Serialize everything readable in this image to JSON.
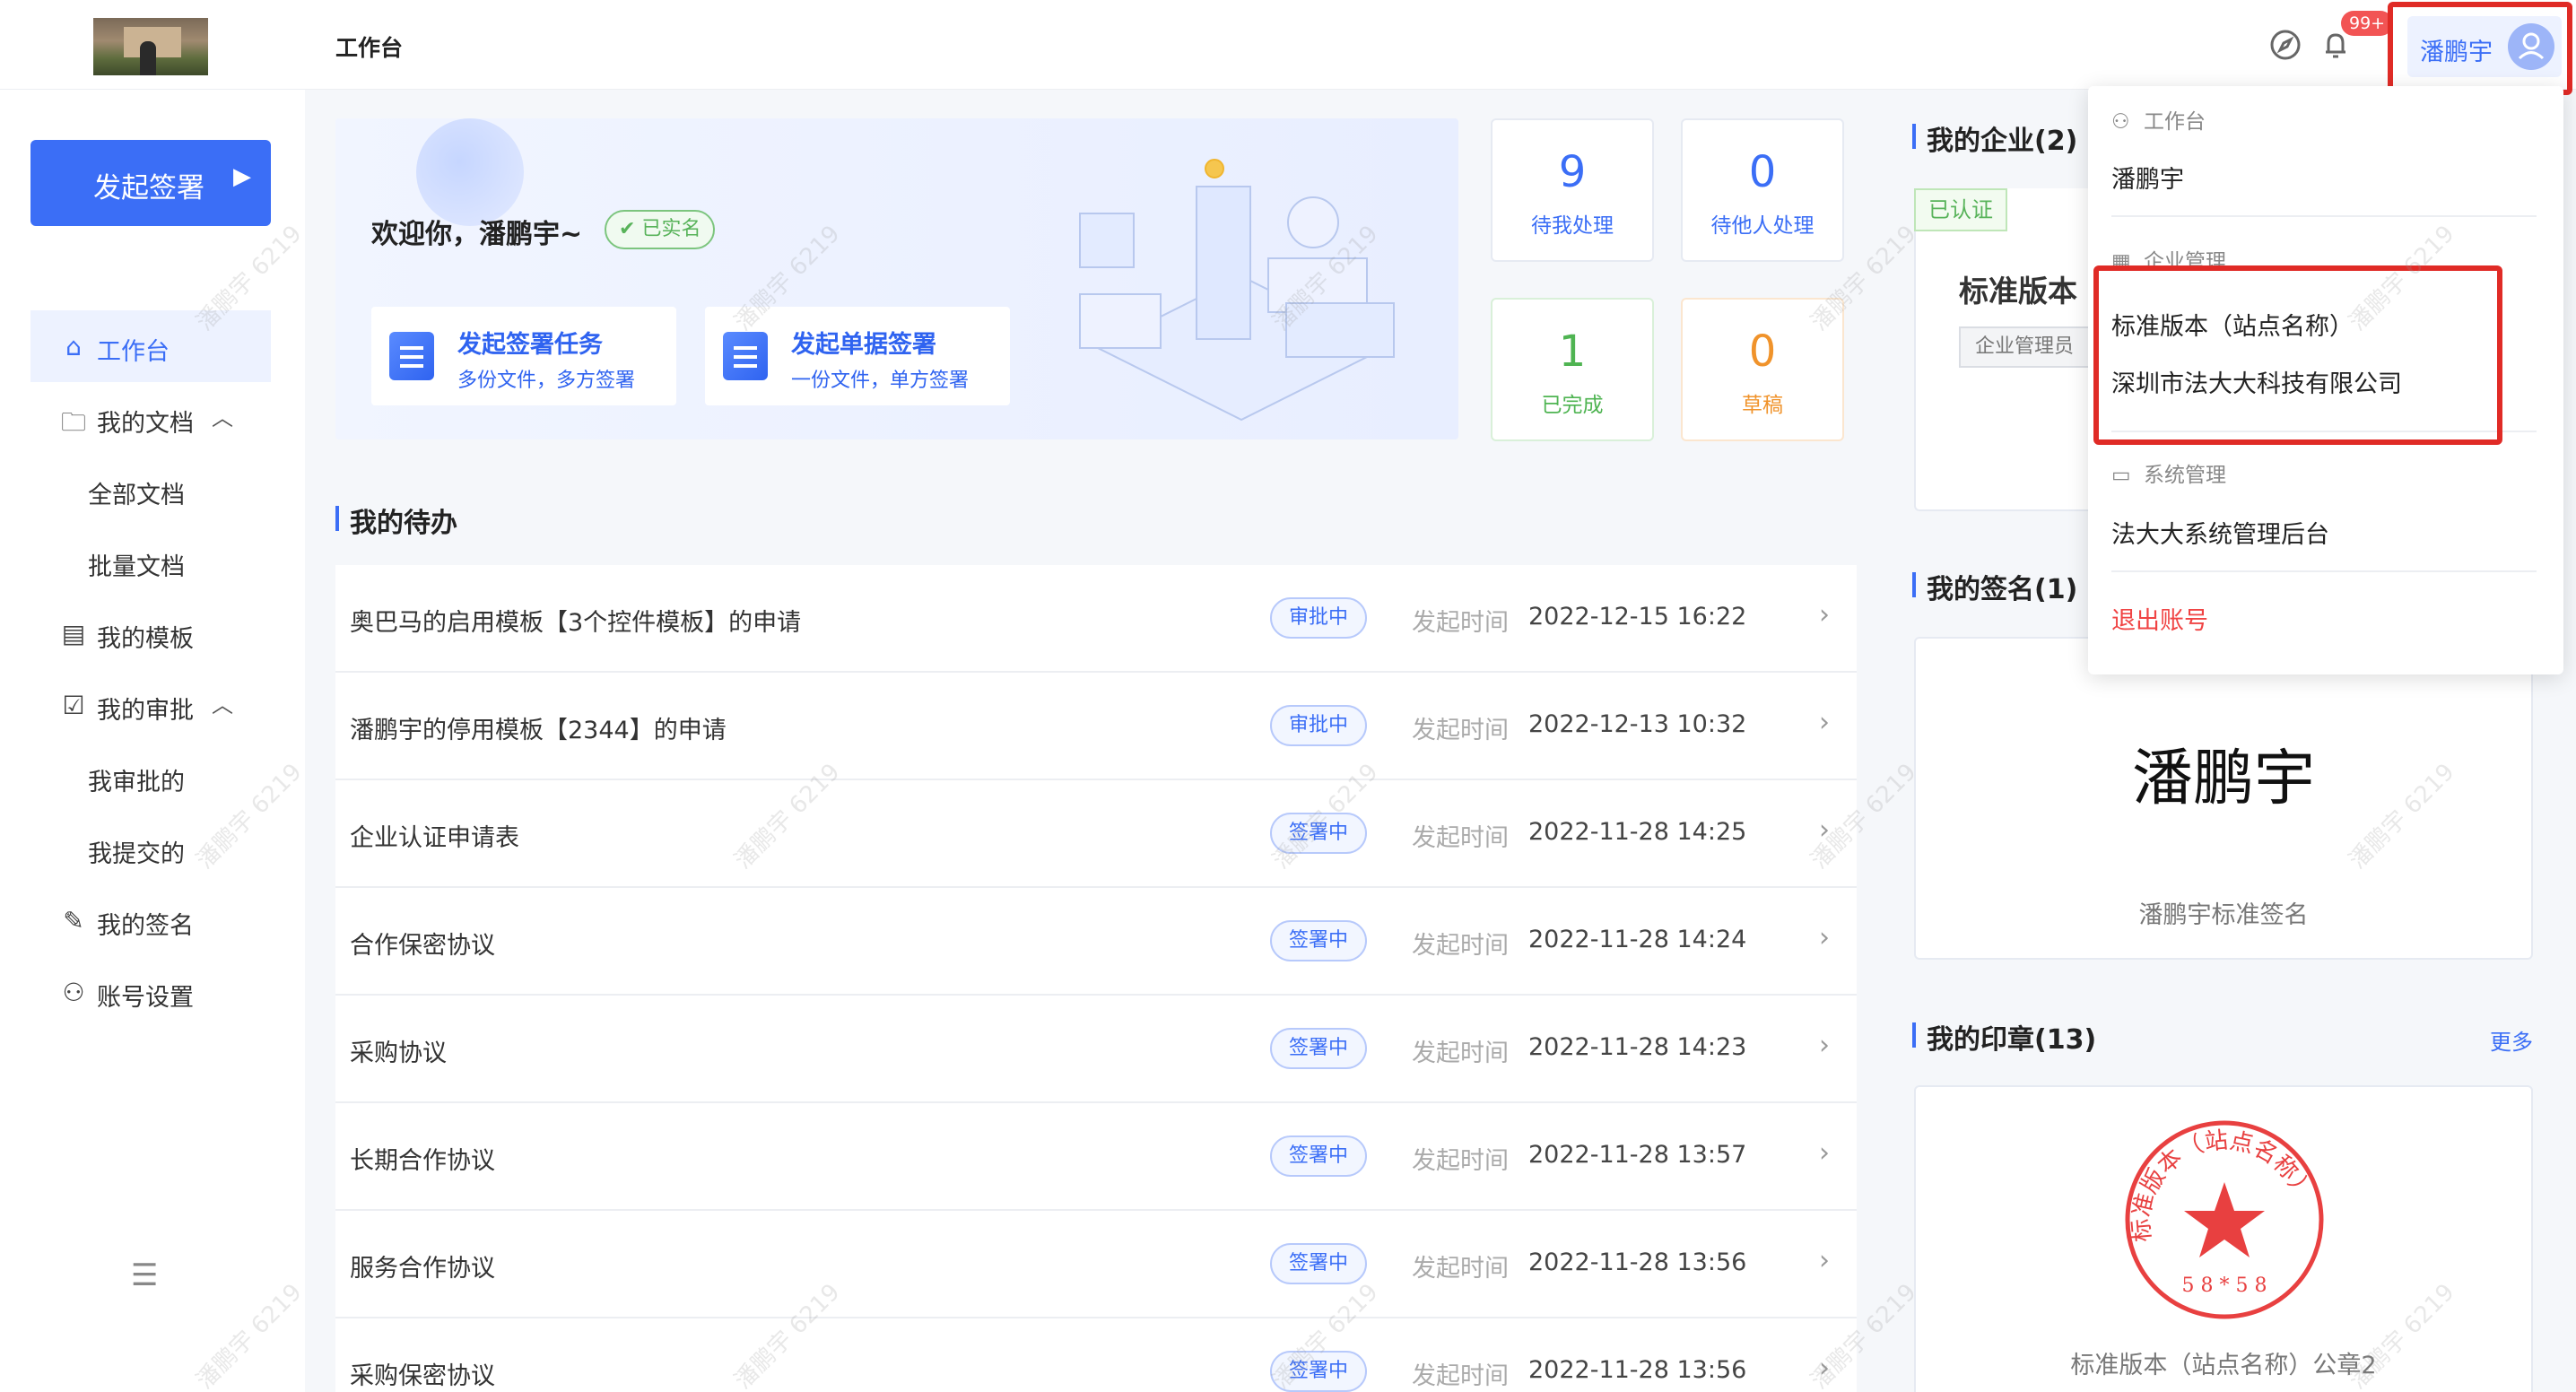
{
  "header": {
    "title": "工作台",
    "notification_badge": "99+",
    "user_name": "潘鹏宇"
  },
  "sidebar": {
    "start_button": "发起签署",
    "items": [
      {
        "label": "工作台",
        "icon": "home-icon"
      },
      {
        "label": "我的文档",
        "icon": "folder-icon"
      },
      {
        "label": "全部文档"
      },
      {
        "label": "批量文档"
      },
      {
        "label": "我的模板",
        "icon": "template-icon"
      },
      {
        "label": "我的审批",
        "icon": "approval-icon"
      },
      {
        "label": "我审批的"
      },
      {
        "label": "我提交的"
      },
      {
        "label": "我的签名",
        "icon": "pen-icon"
      },
      {
        "label": "账号设置",
        "icon": "user-icon"
      }
    ]
  },
  "banner": {
    "welcome": "欢迎你，潘鹏宇~",
    "verified": "已实名",
    "actions": [
      {
        "title": "发起签署任务",
        "subtitle": "多份文件，多方签署"
      },
      {
        "title": "发起单据签署",
        "subtitle": "一份文件，单方签署"
      }
    ]
  },
  "stats": [
    {
      "value": "9",
      "label": "待我处理"
    },
    {
      "value": "0",
      "label": "待他人处理"
    },
    {
      "value": "1",
      "label": "已完成"
    },
    {
      "value": "0",
      "label": "草稿"
    }
  ],
  "todo": {
    "title": "我的待办",
    "time_label": "发起时间",
    "rows": [
      {
        "name": "奥巴马的启用模板【3个控件模板】的申请",
        "status": "审批中",
        "time": "2022-12-15 16:22"
      },
      {
        "name": "潘鹏宇的停用模板【2344】的申请",
        "status": "审批中",
        "time": "2022-12-13 10:32"
      },
      {
        "name": "企业认证申请表",
        "status": "签署中",
        "time": "2022-11-28 14:25"
      },
      {
        "name": "合作保密协议",
        "status": "签署中",
        "time": "2022-11-28 14:24"
      },
      {
        "name": "采购协议",
        "status": "签署中",
        "time": "2022-11-28 14:23"
      },
      {
        "name": "长期合作协议",
        "status": "签署中",
        "time": "2022-11-28 13:57"
      },
      {
        "name": "服务合作协议",
        "status": "签署中",
        "time": "2022-11-28 13:56"
      },
      {
        "name": "采购保密协议",
        "status": "签署中",
        "time": "2022-11-28 13:56"
      }
    ]
  },
  "right": {
    "enterprise_title": "我的企业(2)",
    "cert_tag": "已认证",
    "enterprise_name": "标准版本",
    "role_tag": "企业管理员",
    "signature_title": "我的签名(1)",
    "signature_text": "潘鹏宇",
    "signature_caption": "潘鹏宇标准签名",
    "seal_title": "我的印章(13)",
    "more": "更多",
    "seal_ring_text": "标准版本（站点名称）",
    "seal_code": "5 8 * 5 8",
    "seal_caption": "标准版本（站点名称）公章2",
    "seal_color": "#e84040"
  },
  "dropdown": {
    "workbench_head": "工作台",
    "user_name": "潘鹏宇",
    "enterprise_head": "企业管理",
    "enterprises": [
      "标准版本（站点名称）",
      "深圳市法大大科技有限公司"
    ],
    "system_head": "系统管理",
    "system_item": "法大大系统管理后台",
    "logout": "退出账号"
  },
  "watermark": "潘鹏宇 6219",
  "colors": {
    "accent": "#3b6ef6",
    "highlight": "#e02b26",
    "success": "#4fb452",
    "warning": "#f0932b",
    "danger": "#f04444"
  }
}
